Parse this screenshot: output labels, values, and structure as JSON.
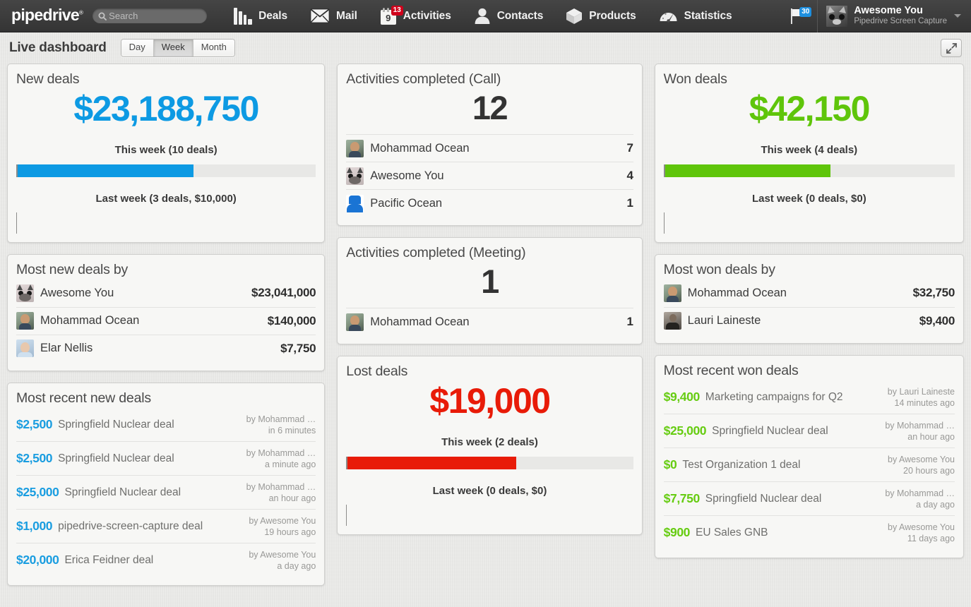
{
  "topbar": {
    "logo": "pipedrive",
    "logo_tm": "®",
    "search_placeholder": "Search",
    "search_value": "",
    "nav": [
      {
        "label": "Deals",
        "icon": "deals-pipeline-icon"
      },
      {
        "label": "Mail",
        "icon": "envelope-icon"
      },
      {
        "label": "Activities",
        "icon": "calendar-icon",
        "calendar_day": "9",
        "badge": "13"
      },
      {
        "label": "Contacts",
        "icon": "person-icon"
      },
      {
        "label": "Products",
        "icon": "box-icon"
      },
      {
        "label": "Statistics",
        "icon": "gauge-icon"
      }
    ],
    "flag": {
      "icon": "flag-icon",
      "badge": "30"
    },
    "user": {
      "name": "Awesome You",
      "subtitle": "Pipedrive Screen Capture",
      "avatar": "cat-avatar"
    }
  },
  "header": {
    "title": "Live dashboard",
    "range_options": [
      "Day",
      "Week",
      "Month"
    ],
    "range_selected": "Week",
    "expand_icon": "expand-arrows-icon"
  },
  "cards": {
    "new_deals": {
      "title": "New deals",
      "amount": "$23,188,750",
      "amount_color": "#0d9ae3",
      "this_week": "This week (10 deals)",
      "last_week": "Last week (3 deals, $10,000)",
      "bar_percent": 59
    },
    "activities_call": {
      "title": "Activities completed (Call)",
      "count": "12",
      "people": [
        {
          "name": "Mohammad Ocean",
          "value": "7",
          "avatar": "av-moh"
        },
        {
          "name": "Awesome You",
          "value": "4",
          "avatar": "av-cat"
        },
        {
          "name": "Pacific Ocean",
          "value": "1",
          "avatar": "av-pac"
        }
      ]
    },
    "won_deals": {
      "title": "Won deals",
      "amount": "$42,150",
      "amount_color": "#5fc50a",
      "this_week": "This week (4 deals)",
      "last_week": "Last week (0 deals, $0)",
      "bar_percent": 57
    },
    "most_new_deals_by": {
      "title": "Most new deals by",
      "people": [
        {
          "name": "Awesome You",
          "value": "$23,041,000",
          "avatar": "av-cat"
        },
        {
          "name": "Mohammad Ocean",
          "value": "$140,000",
          "avatar": "av-moh"
        },
        {
          "name": "Elar Nellis",
          "value": "$7,750",
          "avatar": "av-elar"
        }
      ]
    },
    "activities_meeting": {
      "title": "Activities completed (Meeting)",
      "count": "1",
      "people": [
        {
          "name": "Mohammad Ocean",
          "value": "1",
          "avatar": "av-moh"
        }
      ]
    },
    "most_won_deals_by": {
      "title": "Most won deals by",
      "people": [
        {
          "name": "Mohammad Ocean",
          "value": "$32,750",
          "avatar": "av-moh"
        },
        {
          "name": "Lauri Laineste",
          "value": "$9,400",
          "avatar": "av-lauri"
        }
      ]
    },
    "most_recent_new_deals": {
      "title": "Most recent new deals",
      "deals": [
        {
          "amount": "$2,500",
          "name": "Springfield Nuclear deal",
          "by": "by Mohammad …",
          "time": "in 6 minutes"
        },
        {
          "amount": "$2,500",
          "name": "Springfield Nuclear deal",
          "by": "by Mohammad …",
          "time": "a minute ago"
        },
        {
          "amount": "$25,000",
          "name": "Springfield Nuclear deal",
          "by": "by Mohammad …",
          "time": "an hour ago"
        },
        {
          "amount": "$1,000",
          "name": "pipedrive-screen-capture deal",
          "by": "by Awesome You",
          "time": "19 hours ago"
        },
        {
          "amount": "$20,000",
          "name": "Erica Feidner deal",
          "by": "by Awesome You",
          "time": "a day ago"
        }
      ]
    },
    "lost_deals": {
      "title": "Lost deals",
      "amount": "$19,000",
      "amount_color": "#e81b08",
      "this_week": "This week (2 deals)",
      "last_week": "Last week (0 deals, $0)",
      "bar_percent": 59
    },
    "most_recent_won_deals": {
      "title": "Most recent won deals",
      "deals": [
        {
          "amount": "$9,400",
          "name": "Marketing campaigns for Q2",
          "by": "by Lauri Laineste",
          "time": "14 minutes ago"
        },
        {
          "amount": "$25,000",
          "name": "Springfield Nuclear deal",
          "by": "by Mohammad …",
          "time": "an hour ago"
        },
        {
          "amount": "$0",
          "name": "Test Organization 1 deal",
          "by": "by Awesome You",
          "time": "20 hours ago"
        },
        {
          "amount": "$7,750",
          "name": "Springfield Nuclear deal",
          "by": "by Mohammad …",
          "time": "a day ago"
        },
        {
          "amount": "$900",
          "name": "EU Sales GNB",
          "by": "by Awesome You",
          "time": "11 days ago"
        }
      ]
    }
  }
}
